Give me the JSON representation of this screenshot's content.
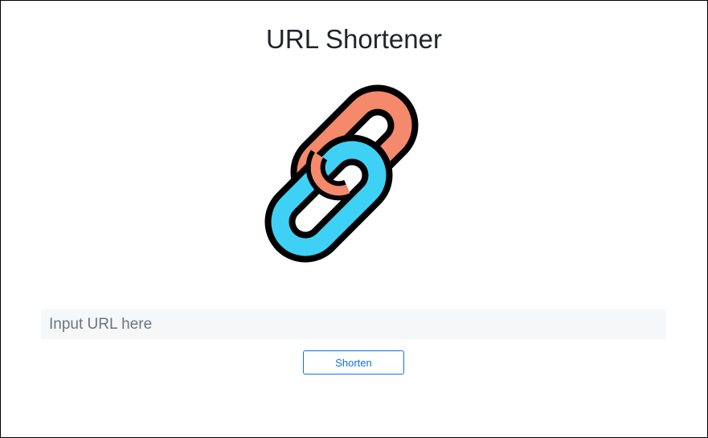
{
  "app": {
    "title": "URL Shortener"
  },
  "logo": {
    "icon": "chain-link-icon",
    "colors": {
      "orange_link": "#f4896b",
      "blue_link": "#3fd0f5",
      "outline": "#000000"
    }
  },
  "form": {
    "url_input": {
      "placeholder": "Input URL here",
      "value": ""
    },
    "shorten_button_label": "Shorten"
  },
  "theme": {
    "accent": "#0d6efd",
    "input_background": "#f6f7f8"
  }
}
